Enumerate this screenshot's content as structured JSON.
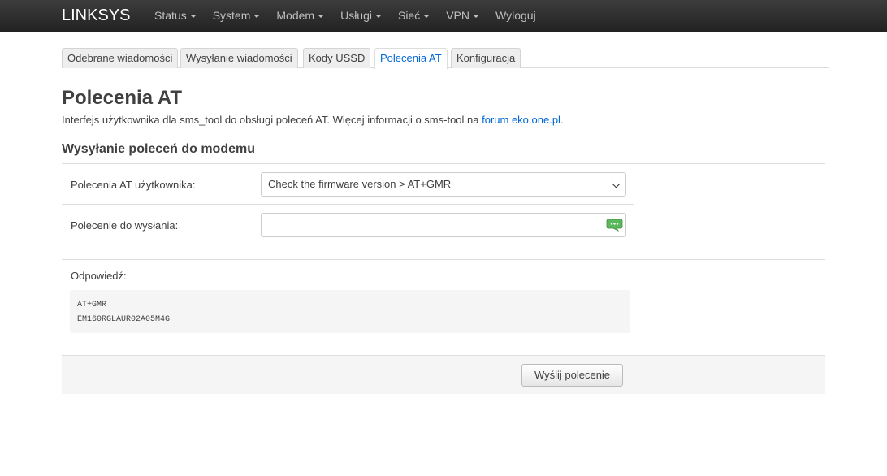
{
  "brand": "LINKSYS",
  "nav": [
    {
      "label": "Status",
      "dropdown": true
    },
    {
      "label": "System",
      "dropdown": true
    },
    {
      "label": "Modem",
      "dropdown": true
    },
    {
      "label": "Usługi",
      "dropdown": true
    },
    {
      "label": "Sieć",
      "dropdown": true
    },
    {
      "label": "VPN",
      "dropdown": true
    },
    {
      "label": "Wyloguj",
      "dropdown": false
    }
  ],
  "tabs": [
    {
      "label": "Odebrane wiadomości",
      "active": false
    },
    {
      "label": "Wysyłanie wiadomości",
      "active": false
    },
    {
      "label": "Kody USSD",
      "active": false
    },
    {
      "label": "Polecenia AT",
      "active": true
    },
    {
      "label": "Konfiguracja",
      "active": false
    }
  ],
  "page": {
    "title": "Polecenia AT",
    "description": "Interfejs użytkownika dla sms_tool do obsługi poleceń AT. Więcej informacji o sms-tool na ",
    "description_link": "forum eko.one.pl.",
    "section_title": "Wysyłanie poleceń do modemu"
  },
  "form": {
    "user_commands_label": "Polecenia AT użytkownika:",
    "user_commands_value": "Check the firmware version > AT+GMR",
    "command_label": "Polecenie do wysłania:",
    "command_value": "",
    "command_icon": "chat-bubble-icon",
    "response_label": "Odpowiedź:",
    "response_text": "AT+GMR\nEM160RGLAUR02A05M4G",
    "submit_label": "Wyślij polecenie"
  },
  "colors": {
    "navbar": "#222222",
    "accent": "#0069d6",
    "icon_green": "#5cb85c"
  }
}
